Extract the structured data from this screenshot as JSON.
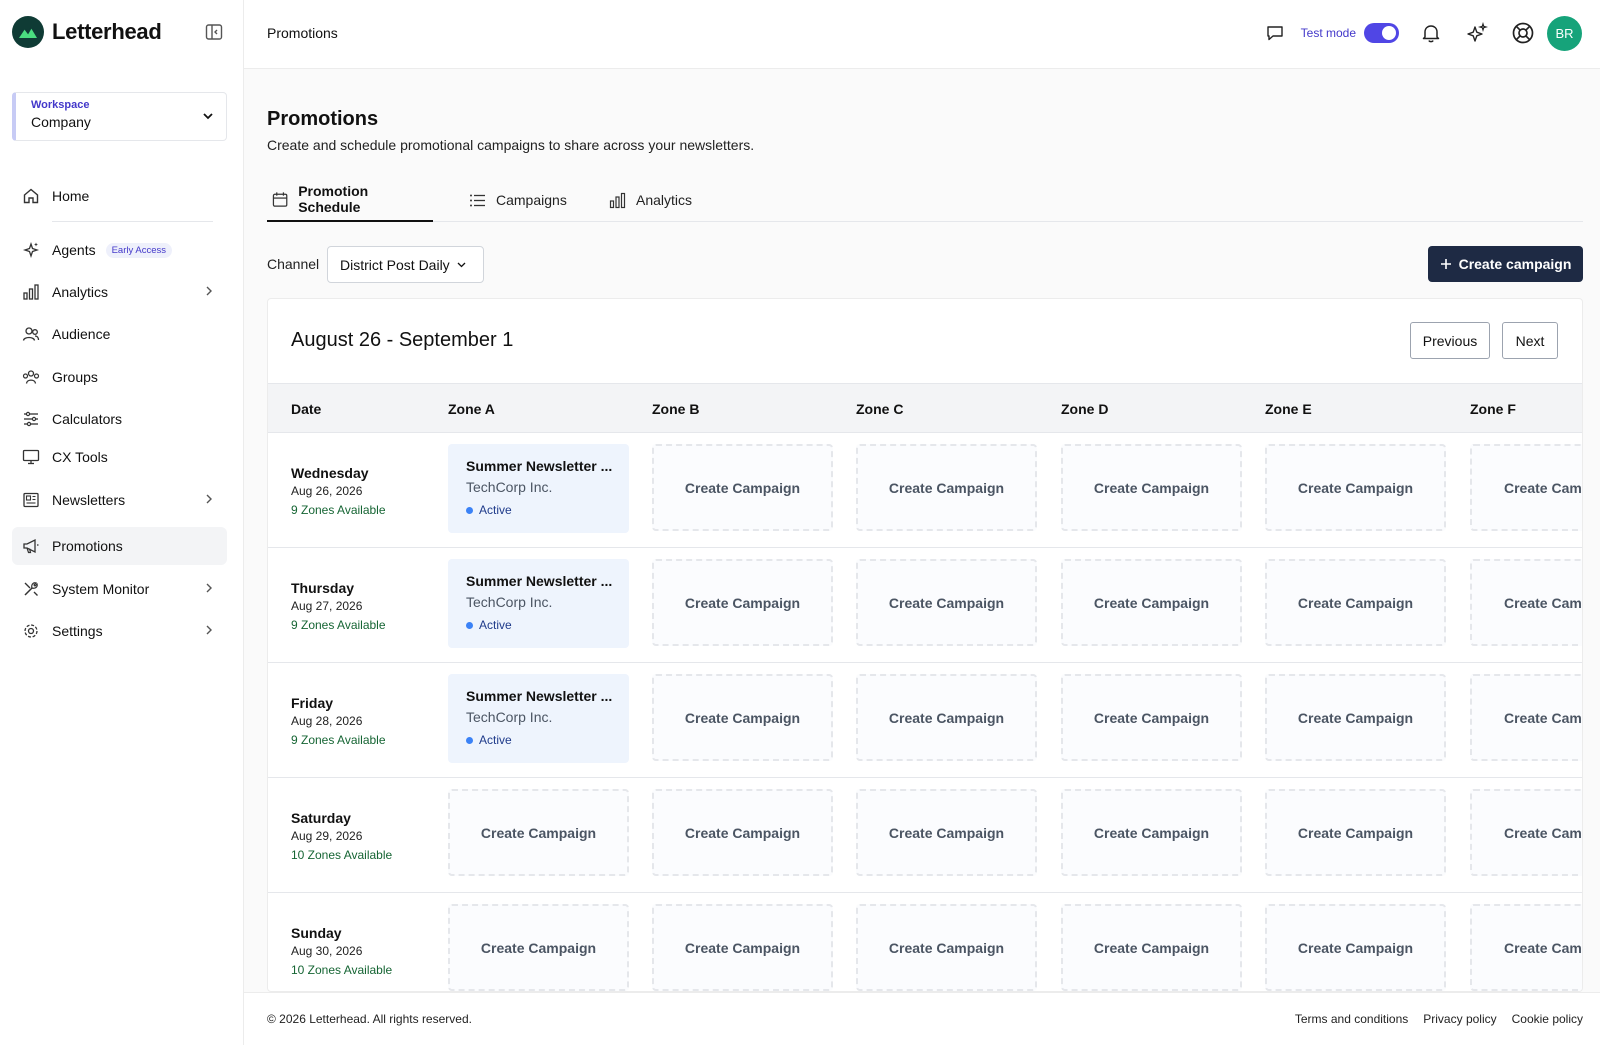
{
  "brand": {
    "name": "Letterhead",
    "color": "#0f3b35"
  },
  "workspace": {
    "label": "Workspace",
    "value": "Company"
  },
  "sidebar": {
    "items": [
      {
        "label": "Home",
        "icon": "home-icon"
      },
      {
        "label": "Agents",
        "icon": "sparkles-icon",
        "badge": "Early Access"
      },
      {
        "label": "Analytics",
        "icon": "bar-chart-icon"
      },
      {
        "label": "Audience",
        "icon": "users-icon"
      },
      {
        "label": "Groups",
        "icon": "group-icon"
      },
      {
        "label": "Calculators",
        "icon": "sliders-icon"
      },
      {
        "label": "CX Tools",
        "icon": "monitor-icon"
      },
      {
        "label": "Newsletters",
        "icon": "newspaper-icon"
      },
      {
        "label": "Promotions",
        "icon": "megaphone-icon",
        "active": true
      },
      {
        "label": "System Monitor",
        "icon": "tools-icon"
      },
      {
        "label": "Settings",
        "icon": "gear-icon"
      }
    ]
  },
  "topbar": {
    "breadcrumb": "Promotions",
    "test_mode_label": "Test mode",
    "test_mode_on": true,
    "avatar_initials": "BR",
    "accent": "#5046e5"
  },
  "page": {
    "title": "Promotions",
    "subtitle": "Create and schedule promotional campaigns to share across your newsletters."
  },
  "tabs": [
    {
      "label": "Promotion Schedule",
      "active": true
    },
    {
      "label": "Campaigns"
    },
    {
      "label": "Analytics"
    }
  ],
  "channel": {
    "label": "Channel",
    "value": "District Post Daily"
  },
  "create_button": "Create campaign",
  "schedule": {
    "week_label": "August 26 - September 1",
    "previous_label": "Previous",
    "next_label": "Next",
    "columns": [
      "Date",
      "Zone A",
      "Zone B",
      "Zone C",
      "Zone D",
      "Zone E",
      "Zone F"
    ],
    "empty_cell_label": "Create Campaign",
    "empty_cell_truncated": "Create Cam",
    "rows": [
      {
        "day": "Wednesday",
        "date": "Aug 26, 2026",
        "zones": "9 Zones Available",
        "promo": {
          "title": "Summer Newsletter ...",
          "company": "TechCorp Inc.",
          "status": "Active"
        }
      },
      {
        "day": "Thursday",
        "date": "Aug 27, 2026",
        "zones": "9 Zones Available",
        "promo": {
          "title": "Summer Newsletter ...",
          "company": "TechCorp Inc.",
          "status": "Active"
        }
      },
      {
        "day": "Friday",
        "date": "Aug 28, 2026",
        "zones": "9 Zones Available",
        "promo": {
          "title": "Summer Newsletter ...",
          "company": "TechCorp Inc.",
          "status": "Active"
        }
      },
      {
        "day": "Saturday",
        "date": "Aug 29, 2026",
        "zones": "10 Zones Available"
      },
      {
        "day": "Sunday",
        "date": "Aug 30, 2026",
        "zones": "10 Zones Available"
      }
    ]
  },
  "footer": {
    "copyright": "© 2026 Letterhead. All rights reserved.",
    "links": [
      "Terms and conditions",
      "Privacy policy",
      "Cookie policy"
    ]
  }
}
